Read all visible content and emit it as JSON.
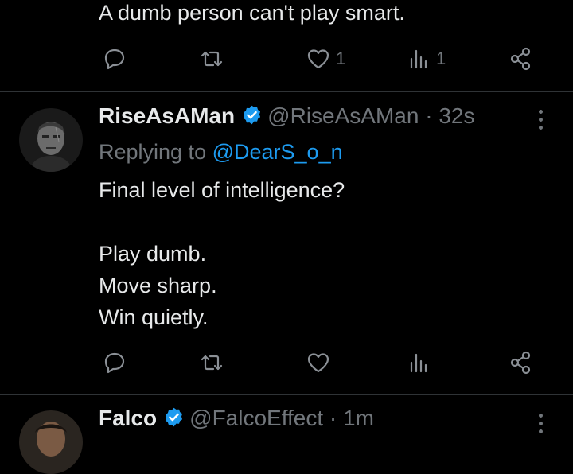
{
  "tweets": [
    {
      "text_lines": [
        "A dumb person can't play smart."
      ],
      "actions": {
        "reply": "",
        "retweet": "",
        "like": "1",
        "views": "1"
      }
    },
    {
      "name": "RiseAsAMan",
      "handle_time": "@RiseAsAMan · 32s",
      "replying_prefix": "Replying to ",
      "replying_to": "@DearS_o_n",
      "text_lines": [
        "Final level of intelligence?",
        "",
        "Play dumb.",
        "Move sharp.",
        "Win quietly."
      ],
      "actions": {
        "reply": "",
        "retweet": "",
        "like": "",
        "views": ""
      }
    },
    {
      "name": "Falco",
      "handle_time": "@FalcoEffect · 1m"
    }
  ],
  "colors": {
    "background": "#000000",
    "text": "#e7e9ea",
    "muted": "#71767b",
    "accent": "#1d9bf0"
  },
  "icons": [
    "reply-icon",
    "retweet-icon",
    "like-icon",
    "views-icon",
    "share-icon",
    "verified-badge-icon",
    "more-icon"
  ]
}
